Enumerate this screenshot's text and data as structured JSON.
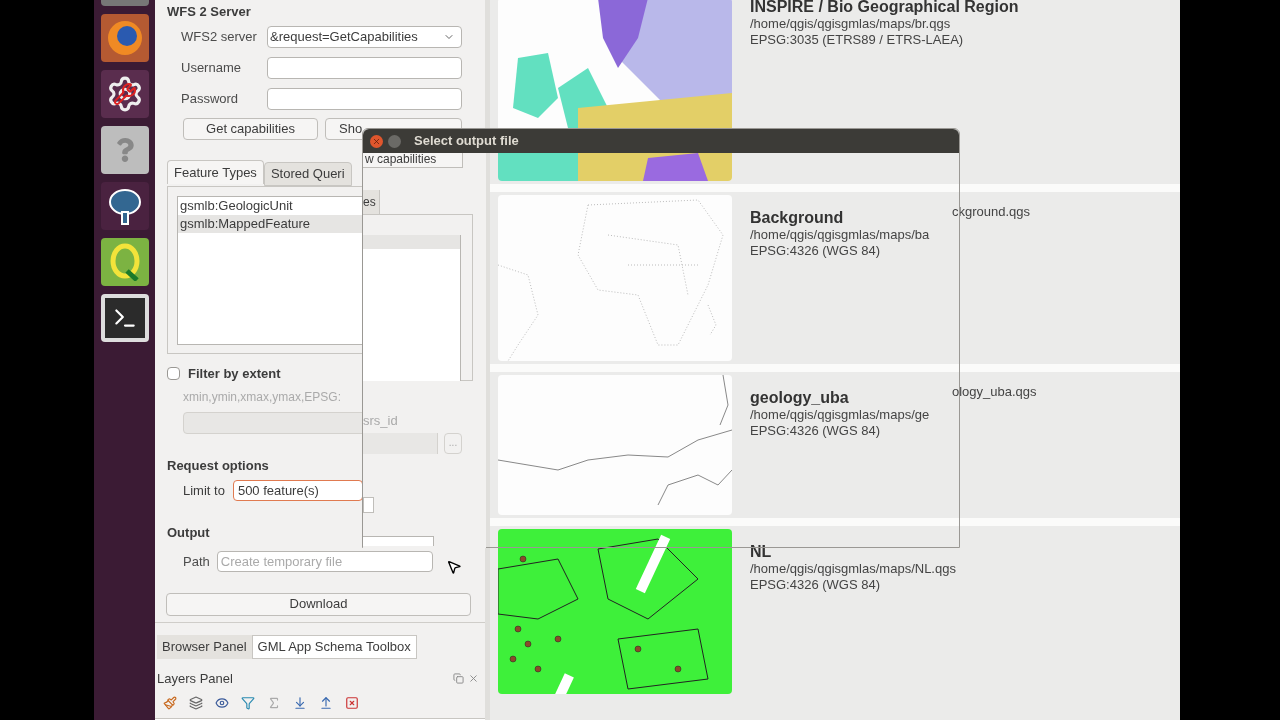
{
  "wfs_panel": {
    "title": "WFS 2 Server",
    "fields": [
      {
        "label": "WFS2 server",
        "value": "&request=GetCapabilities",
        "kind": "combo"
      },
      {
        "label": "Username",
        "kind": "text"
      },
      {
        "label": "Password",
        "kind": "text"
      }
    ],
    "buttons": [
      "Get capabilities",
      "Sho"
    ],
    "tabs": [
      {
        "label": "Feature Types",
        "selected": true
      },
      {
        "label": "Stored Queri",
        "selected": false
      }
    ],
    "feature_types": [
      {
        "label": "gsmlb:GeologicUnit",
        "selected": false
      },
      {
        "label": "gsmlb:MappedFeature",
        "selected": true
      }
    ],
    "filter": {
      "label": "Filter by extent",
      "checked": false,
      "hint": "xmin,ymin,xmax,ymax,EPSG:"
    },
    "request_options": {
      "title": "Request options",
      "limit_label": "Limit to",
      "limit_value": "500 feature(s)"
    },
    "output": {
      "title": "Output",
      "path_label": "Path",
      "path_placeholder": "Create temporary file"
    },
    "download_button": "Download"
  },
  "dock_tabs": [
    {
      "label": "Browser Panel",
      "selected": false
    },
    {
      "label": "GML App Schema Toolbox",
      "selected": true
    }
  ],
  "layers_panel": {
    "title": "Layers Panel"
  },
  "dialog": {
    "title": "Select output file",
    "ghost_button": "w capabilities",
    "ghost_tab": "es",
    "ghost_label": "srs_id",
    "ghost_browse": "..."
  },
  "projects": [
    {
      "title": "INSPIRE / Bio Geographical Region",
      "path": "/home/qgis/qgisgmlas/maps/br.qgs",
      "crs": "EPSG:3035 (ETRS89 / ETRS-LAEA)"
    },
    {
      "title": "Background",
      "path": "/home/qgis/qgisgmlas/maps/ba",
      "path_tail": "ckground.qgs",
      "crs": "EPSG:4326 (WGS 84)"
    },
    {
      "title": "geology_uba",
      "path": "/home/qgis/qgisgmlas/maps/ge",
      "path_tail": "ology_uba.qgs",
      "crs": "EPSG:4326 (WGS 84)"
    },
    {
      "title": "NL",
      "path": "/home/qgis/qgisgmlas/maps/NL.qgs",
      "crs": "EPSG:4326 (WGS 84)"
    }
  ]
}
